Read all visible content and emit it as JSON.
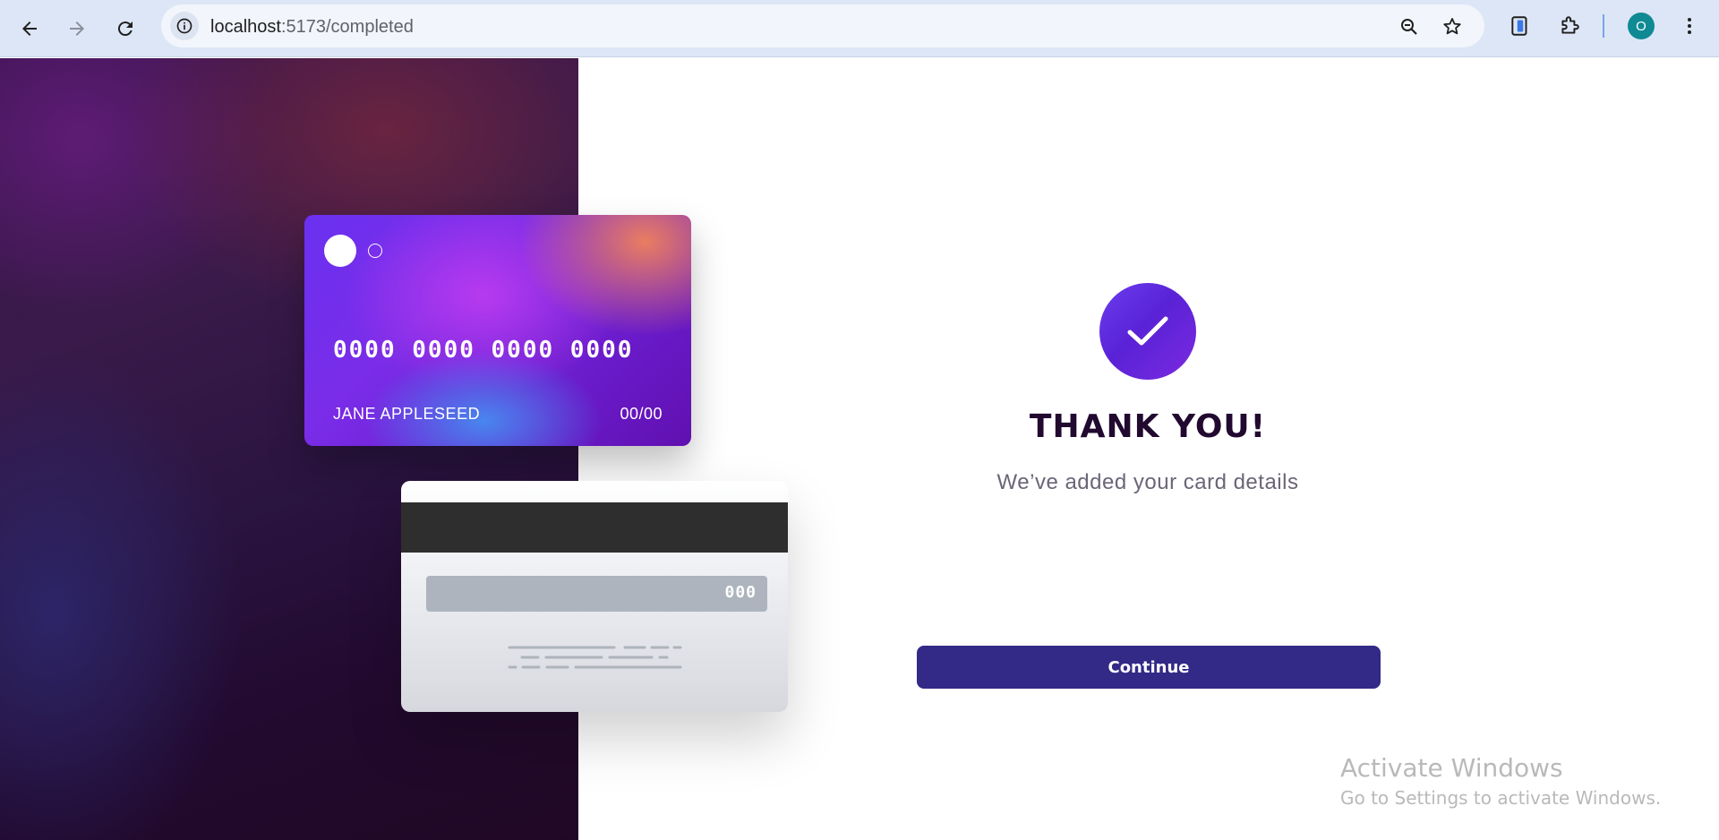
{
  "browser": {
    "url_host": "localhost",
    "url_path": ":5173/completed",
    "profile_initial": "O",
    "icons": {
      "back": "arrow-left-icon",
      "forward": "arrow-right-icon",
      "reload": "reload-icon",
      "site_info": "info-icon",
      "zoom": "zoom-out-icon",
      "bookmark": "star-icon",
      "tab_search": "phone-device-icon",
      "extensions": "puzzle-icon",
      "menu": "kebab-menu-icon"
    }
  },
  "card_front": {
    "number": "0000 0000 0000 0000",
    "name": "JANE APPLESEED",
    "expiry": "00/00"
  },
  "card_back": {
    "cvc": "000"
  },
  "confirmation": {
    "title": "THANK YOU!",
    "subtitle": "We’ve added your card details",
    "button_label": "Continue"
  },
  "watermark": {
    "title": "Activate Windows",
    "subtitle": "Go to Settings to activate Windows."
  },
  "colors": {
    "button": "#332986",
    "title": "#21092f",
    "subtitle": "#6b6577",
    "check_gradient_start": "#6b3ef0",
    "check_gradient_end": "#7b2ae0"
  }
}
